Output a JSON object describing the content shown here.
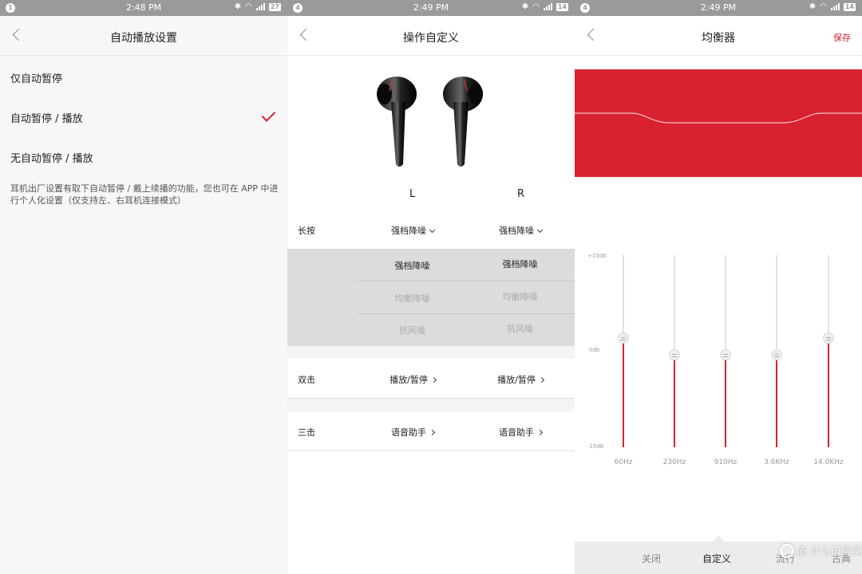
{
  "screen1": {
    "status": {
      "notif": "1",
      "time": "2:48 PM",
      "battery": "27"
    },
    "title": "自动播放设置",
    "options": [
      "仅自动暂停",
      "自动暂停 / 播放",
      "无自动暂停 / 播放"
    ],
    "selected_index": 1,
    "note": "耳机出厂设置有取下自动暂停 / 戴上续播的功能，您也可在 APP 中进行个人化设置（仅支持左、右耳机连接模式）"
  },
  "screen2": {
    "status": {
      "notif": "4",
      "time": "2:49 PM",
      "battery": "14"
    },
    "title": "操作自定义",
    "left_label": "L",
    "right_label": "R",
    "long_press": {
      "label": "长按",
      "left": "强档降噪",
      "right": "强档降噪"
    },
    "picker": {
      "left": [
        "强档降噪",
        "均衡降噪",
        "抗风噪"
      ],
      "right": [
        "强档降噪",
        "均衡降噪",
        "抗风噪"
      ]
    },
    "double_tap": {
      "label": "双击",
      "left": "播放/暂停",
      "right": "播放/暂停"
    },
    "triple_tap": {
      "label": "三击",
      "left": "语音助手",
      "right": "语音助手"
    }
  },
  "screen3": {
    "status": {
      "notif": "4",
      "time": "2:49 PM",
      "battery": "14"
    },
    "title": "均衡器",
    "save_label": "保存",
    "scale": {
      "top": "+15db",
      "mid": "0db",
      "bottom": "-15db"
    },
    "bands": [
      {
        "hz": "60Hz",
        "db": 2
      },
      {
        "hz": "230Hz",
        "db": -0.5
      },
      {
        "hz": "910Hz",
        "db": -0.5
      },
      {
        "hz": "3.6KHz",
        "db": -0.5
      },
      {
        "hz": "14.0KHz",
        "db": 2
      }
    ],
    "tabs": [
      "关闭",
      "自定义",
      "流行",
      "古典"
    ],
    "active_tab": 1,
    "watermark": "值 什么值得买"
  },
  "colors": {
    "accent": "#d3232f",
    "statusbar": "#9a9a9a"
  }
}
